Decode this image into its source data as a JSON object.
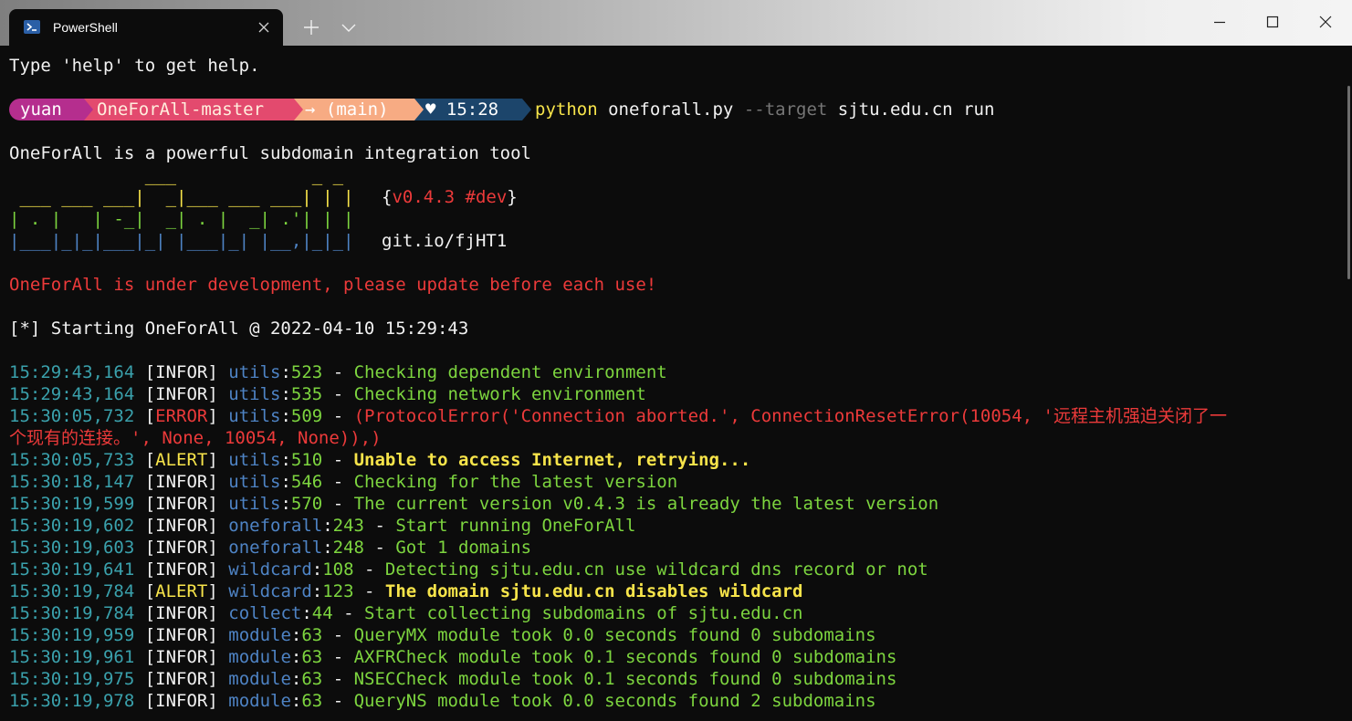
{
  "window": {
    "tab_title": "PowerShell",
    "tab_icon": "powershell-icon",
    "controls": [
      "minimize-icon",
      "maximize-icon",
      "close-icon"
    ]
  },
  "colors": {
    "user_segment": "#b52e8e",
    "dir_segment": "#e34a6e",
    "git_segment": "#f7ab83",
    "time_segment": "#1c456b",
    "timestamp": "#3aa1ac",
    "module": "#4e83c4",
    "message": "#7dd53f",
    "error": "#ec3a3a",
    "alert": "#f7e44a"
  },
  "terminal": {
    "help_line": "Type 'help' to get help.",
    "prompt": {
      "user": "yuan",
      "directory": "OneForAll-master",
      "git_branch": "→ (main)",
      "time": "♥ 15:28"
    },
    "command": {
      "program": "python",
      "script": "oneforall.py",
      "flag": "--target",
      "target": "sjtu.edu.cn",
      "action": "run"
    },
    "tagline": "OneForAll is a powerful subdomain integration tool",
    "banner": {
      "art_line_1": "             ___             _ _",
      "art_line_2": " ___ ___ ___|  _|___ ___ ___| | |",
      "art_line_3": "| . |   | -_|  _| . |  _| .'| | |",
      "art_line_4": "|___|_|_|___|_| |___|_| |__,|_|_|",
      "version_open": "{",
      "version": "v0.4.3 #dev",
      "version_close": "}",
      "link": "git.io/fjHT1"
    },
    "warning": "OneForAll is under development, please update before each use!",
    "starting": "[*] Starting OneForAll @ 2022-04-10 15:29:43",
    "logs": [
      {
        "ts": "15:29:43,164",
        "level": "INFOR",
        "module": "utils",
        "line": "523",
        "msg": "Checking dependent environment"
      },
      {
        "ts": "15:29:43,164",
        "level": "INFOR",
        "module": "utils",
        "line": "535",
        "msg": "Checking network environment"
      },
      {
        "ts": "15:30:05,732",
        "level": "ERROR",
        "module": "utils",
        "line": "509",
        "msg": "(ProtocolError('Connection aborted.', ConnectionResetError(10054, '远程主机强迫关闭了一",
        "msg_cont": "个现有的连接。', None, 10054, None)),)"
      },
      {
        "ts": "15:30:05,733",
        "level": "ALERT",
        "module": "utils",
        "line": "510",
        "msg": "Unable to access Internet, retrying..."
      },
      {
        "ts": "15:30:18,147",
        "level": "INFOR",
        "module": "utils",
        "line": "546",
        "msg": "Checking for the latest version"
      },
      {
        "ts": "15:30:19,599",
        "level": "INFOR",
        "module": "utils",
        "line": "570",
        "msg": "The current version v0.4.3 is already the latest version"
      },
      {
        "ts": "15:30:19,602",
        "level": "INFOR",
        "module": "oneforall",
        "line": "243",
        "msg": "Start running OneForAll"
      },
      {
        "ts": "15:30:19,603",
        "level": "INFOR",
        "module": "oneforall",
        "line": "248",
        "msg": "Got 1 domains"
      },
      {
        "ts": "15:30:19,641",
        "level": "INFOR",
        "module": "wildcard",
        "line": "108",
        "msg": "Detecting sjtu.edu.cn use wildcard dns record or not"
      },
      {
        "ts": "15:30:19,784",
        "level": "ALERT",
        "module": "wildcard",
        "line": "123",
        "msg": "The domain sjtu.edu.cn disables wildcard"
      },
      {
        "ts": "15:30:19,784",
        "level": "INFOR",
        "module": "collect",
        "line": "44",
        "msg": "Start collecting subdomains of sjtu.edu.cn"
      },
      {
        "ts": "15:30:19,959",
        "level": "INFOR",
        "module": "module",
        "line": "63",
        "msg": "QueryMX module took 0.0 seconds found 0 subdomains"
      },
      {
        "ts": "15:30:19,961",
        "level": "INFOR",
        "module": "module",
        "line": "63",
        "msg": "AXFRCheck module took 0.1 seconds found 0 subdomains"
      },
      {
        "ts": "15:30:19,975",
        "level": "INFOR",
        "module": "module",
        "line": "63",
        "msg": "NSECCheck module took 0.1 seconds found 0 subdomains"
      },
      {
        "ts": "15:30:19,978",
        "level": "INFOR",
        "module": "module",
        "line": "63",
        "msg": "QueryNS module took 0.0 seconds found 2 subdomains"
      }
    ]
  }
}
